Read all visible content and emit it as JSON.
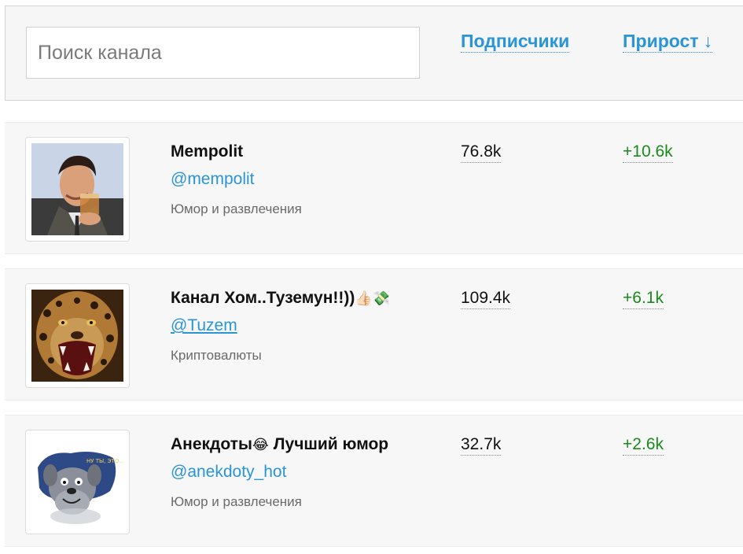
{
  "search": {
    "placeholder": "Поиск канала",
    "value": ""
  },
  "sort": {
    "subscribers_label": "Подписчики",
    "growth_label": "Прирост",
    "growth_arrow": "↓"
  },
  "channels": [
    {
      "title": "Mempolit",
      "title_emoji": "",
      "handle": "@mempolit",
      "category": "Юмор и развлечения",
      "subscribers": "76.8k",
      "growth": "+10.6k",
      "avatar_icon": "man-drinking-avatar"
    },
    {
      "title": "Канал Хом..Туземун!!))",
      "title_emoji": "👍🏻💸",
      "handle": "@Tuzem",
      "category": "Криптовалюты",
      "subscribers": "109.4k",
      "growth": "+6.1k",
      "avatar_icon": "leopard-avatar"
    },
    {
      "title": "Анекдоты",
      "title_emoji": "😂",
      "title_suffix": " Лучший юмор",
      "handle": "@anekdoty_hot",
      "category": "Юмор и развлечения",
      "subscribers": "32.7k",
      "growth": "+2.6k",
      "avatar_icon": "cartoon-dog-avatar",
      "avatar_text": "НУ ТЫ, ЭТО... ЗАХОДИ, ЕСЛИ ЧТО..."
    }
  ],
  "colors": {
    "link": "#2a95d6",
    "growth": "#1a8a1a",
    "row_bg": "#f7f7f7"
  }
}
